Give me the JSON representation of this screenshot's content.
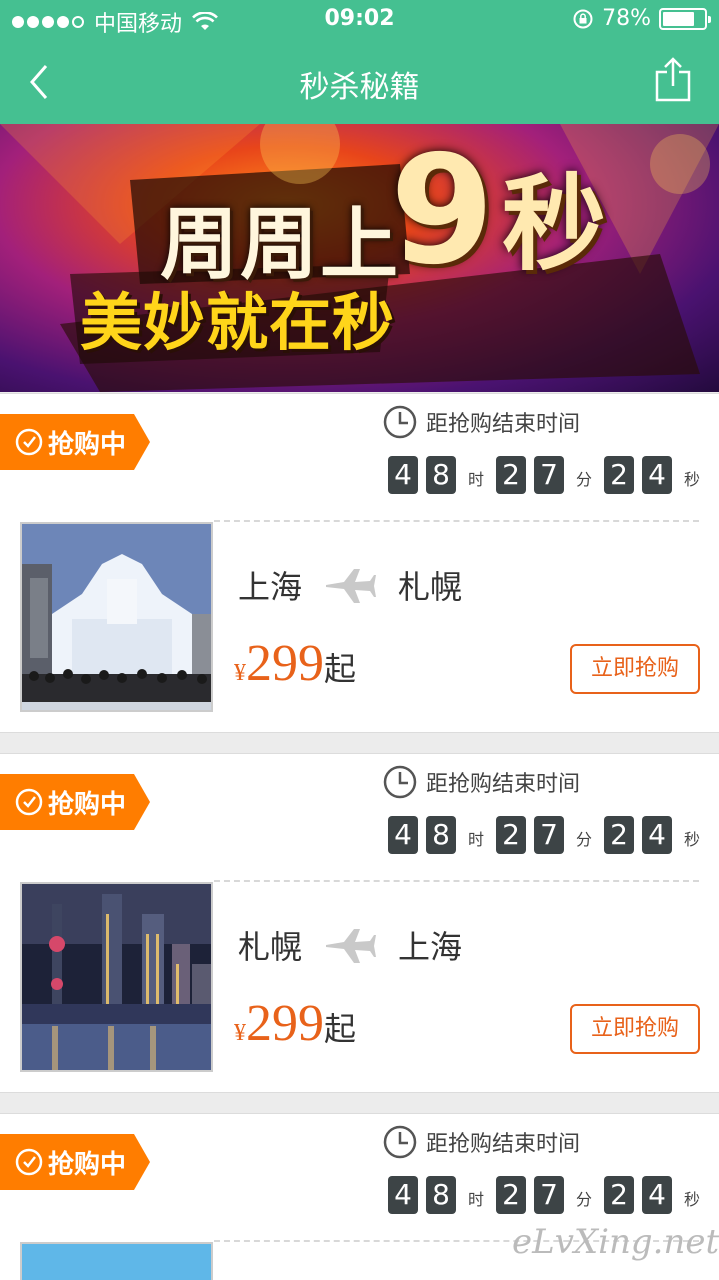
{
  "status_bar": {
    "carrier": "中国移动",
    "time": "09:02",
    "battery": "78%",
    "battery_level": 0.78,
    "signal_icon": "signal-dots-icon",
    "wifi_icon": "wifi-icon",
    "lock_icon": "rotation-lock-icon"
  },
  "nav": {
    "title": "秒杀秘籍",
    "back_icon": "chevron-left-icon",
    "share_icon": "share-icon",
    "bg_color": "#45c091"
  },
  "banner": {
    "line1": "周周上",
    "nine": "9",
    "miao": "秒",
    "line2": "美妙就在秒"
  },
  "deals": [
    {
      "tag": "抢购中",
      "countdown_label": "距抢购结束时间",
      "hours": [
        "4",
        "8"
      ],
      "minutes": [
        "2",
        "7"
      ],
      "seconds": [
        "2",
        "4"
      ],
      "unit_h": "时",
      "unit_m": "分",
      "unit_s": "秒",
      "from": "上海",
      "to": "札幌",
      "yen": "¥",
      "price": "299",
      "qi": "起",
      "buy": "立即抢购"
    },
    {
      "tag": "抢购中",
      "countdown_label": "距抢购结束时间",
      "hours": [
        "4",
        "8"
      ],
      "minutes": [
        "2",
        "7"
      ],
      "seconds": [
        "2",
        "4"
      ],
      "unit_h": "时",
      "unit_m": "分",
      "unit_s": "秒",
      "from": "札幌",
      "to": "上海",
      "yen": "¥",
      "price": "299",
      "qi": "起",
      "buy": "立即抢购"
    },
    {
      "tag": "抢购中",
      "countdown_label": "距抢购结束时间",
      "hours": [
        "4",
        "8"
      ],
      "minutes": [
        "2",
        "7"
      ],
      "seconds": [
        "2",
        "4"
      ],
      "unit_h": "时",
      "unit_m": "分",
      "unit_s": "秒"
    }
  ],
  "colors": {
    "accent": "#ff7d00",
    "price": "#e8621a",
    "digit_bg": "#3d4446"
  },
  "watermark": "eLvXing.net"
}
